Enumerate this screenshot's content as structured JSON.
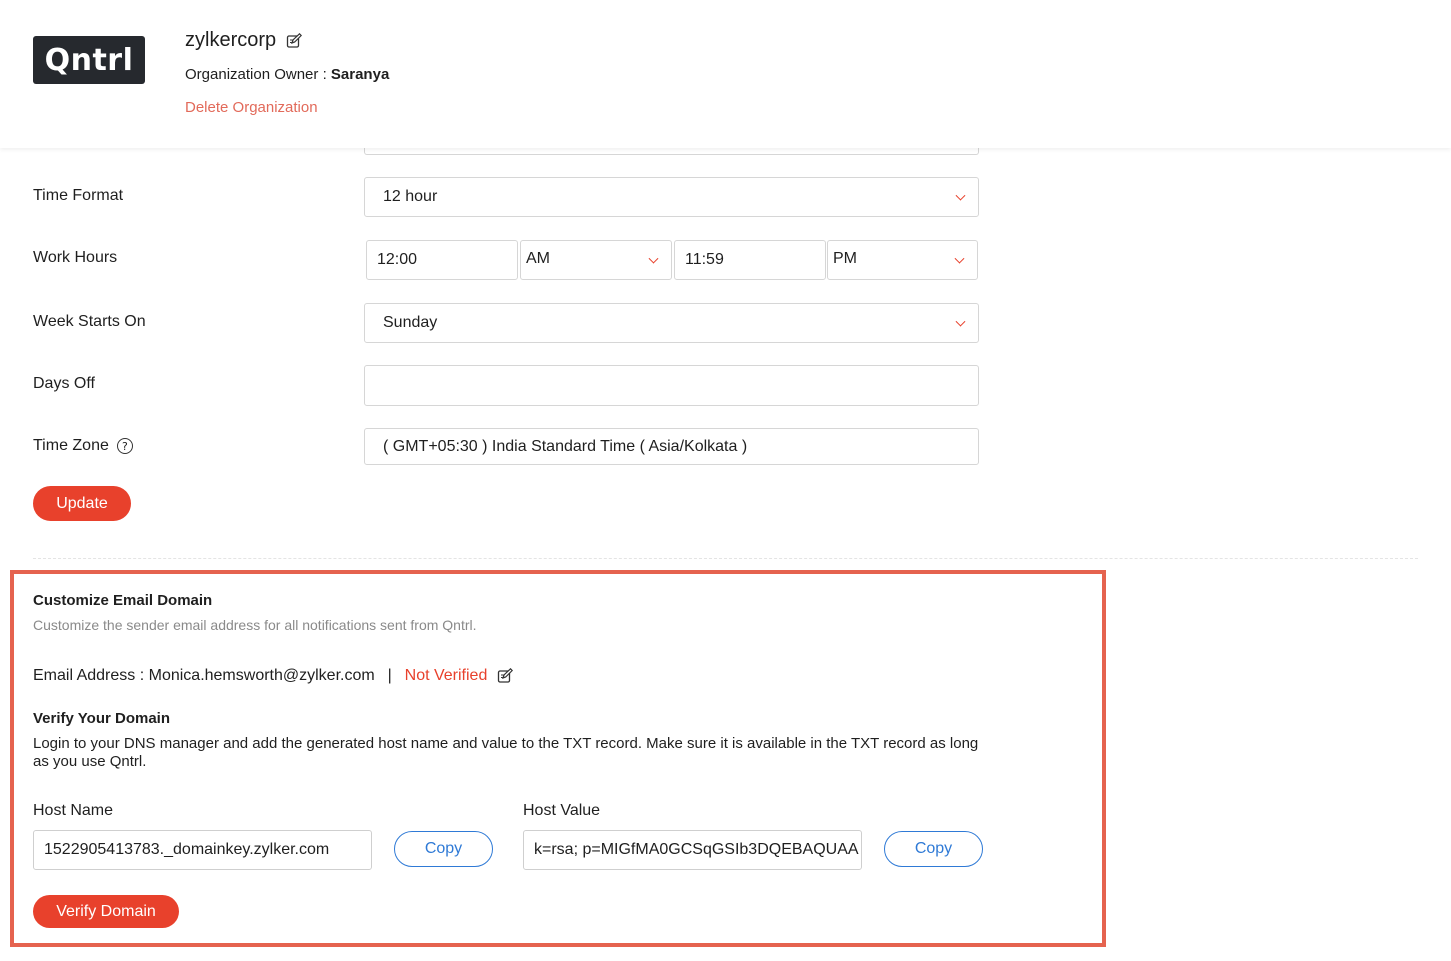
{
  "header": {
    "logo_text": "Qntrl",
    "org_name": "zylkercorp",
    "owner_label": "Organization Owner : ",
    "owner_name": "Saranya",
    "delete_label": "Delete Organization"
  },
  "settings": {
    "time_format": {
      "label": "Time Format",
      "value": "12 hour"
    },
    "work_hours": {
      "label": "Work Hours",
      "start_time": "12:00",
      "start_period": "AM",
      "end_time": "11:59",
      "end_period": "PM"
    },
    "week_starts_on": {
      "label": "Week Starts On",
      "value": "Sunday"
    },
    "days_off": {
      "label": "Days Off",
      "value": ""
    },
    "time_zone": {
      "label": "Time Zone",
      "value": "( GMT+05:30 ) India Standard Time ( Asia/Kolkata )",
      "help_icon": "question-circle-icon"
    },
    "update_label": "Update"
  },
  "email_domain": {
    "title": "Customize Email Domain",
    "description": "Customize the sender email address for all notifications sent from Qntrl.",
    "email_prefix": "Email Address : ",
    "email": "Monica.hemsworth@zylker.com",
    "separator": "  |  ",
    "status": "Not Verified",
    "verify_title": "Verify Your Domain",
    "verify_desc": "Login to your DNS manager and add the generated host name and value to the TXT record. Make sure it is available in the TXT record as long as you use Qntrl.",
    "host_name_label": "Host Name",
    "host_name_value": "1522905413783._domainkey.zylker.com",
    "host_value_label": "Host Value",
    "host_value_value": "k=rsa; p=MIGfMA0GCSqGSIb3DQEBAQUAA",
    "copy_label": "Copy",
    "verify_button": "Verify Domain"
  },
  "colors": {
    "accent": "#e8412c",
    "link_blue": "#2f7ad6",
    "highlight_border": "#e5634f"
  }
}
